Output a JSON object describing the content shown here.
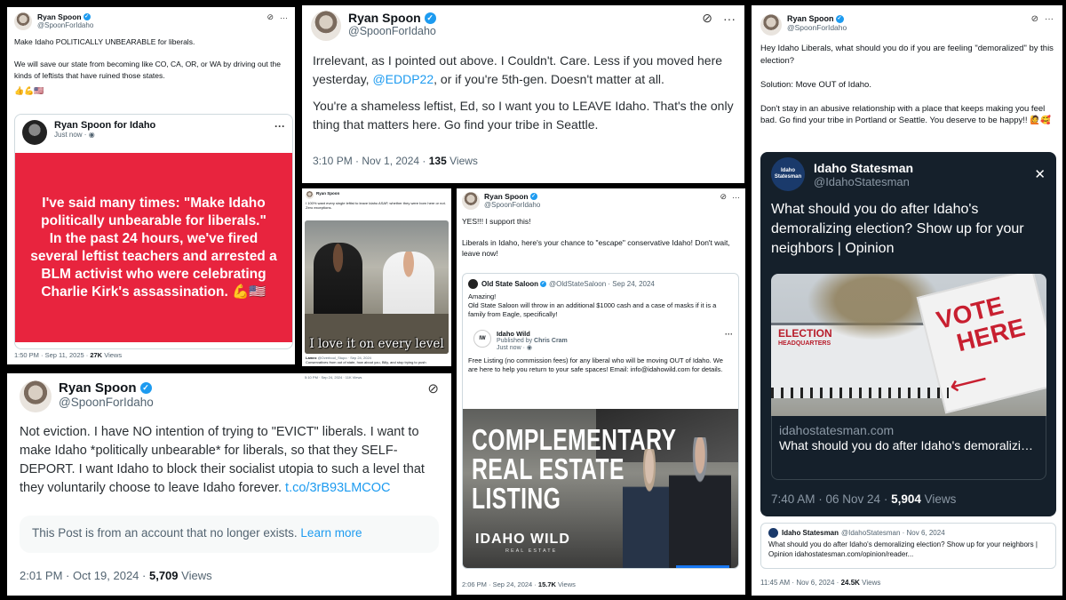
{
  "p1": {
    "name": "Ryan Spoon",
    "handle": "@SpoonForIdaho",
    "text": "Make Idaho POLITICALLY UNBEARABLE for liberals.\n\nWe will save our state from becoming like CO, CA, OR, or WA by driving out the kinds of leftists that have ruined those states.",
    "emoji": "👍💪🇺🇸",
    "card_name": "Ryan Spoon for Idaho",
    "card_time": "Just now ·",
    "banner": "I've said many times: \"Make Idaho politically unbearable for liberals.\"\nIn the past 24 hours, we've fired several leftist teachers and arrested a BLM activist who were celebrating Charlie Kirk's assassination. 💪🇺🇸",
    "time": "1:50 PM · Sep 11, 2025 ·",
    "views": "27K",
    "views_label": "Views"
  },
  "p2": {
    "name": "Ryan Spoon",
    "handle": "@SpoonForIdaho",
    "text_a": "Irrelevant, as I pointed out above. I Couldn't. Care. Less if you moved here yesterday, ",
    "mention": "@EDDP22",
    "text_b": ", or if you're 5th-gen. Doesn't matter at all.",
    "text_c": "You're a shameless leftist, Ed, so I want you to LEAVE Idaho. That's the only thing that matters here. Go find your tribe in Seattle.",
    "time": "3:10 PM · Nov 1, 2024 ·",
    "views": "135",
    "views_label": "Views"
  },
  "p3": {
    "name": "Ryan Spoon",
    "text": "I 100% want every single leftist to leave Idaho ASAP, whether they were born here or not. Zero exceptions.",
    "caption": "I love it on every level",
    "reply_name": "Lamez",
    "reply_meta": "@Overbool_Stupo · Sep 24, 2024",
    "reply_text": "Conservatives from out of state, how about you, Billy, and stop trying to push",
    "timestamp": "5:10 PM · Sep 24, 2024 · 11K Views"
  },
  "p4": {
    "name": "Ryan Spoon",
    "handle": "@SpoonForIdaho",
    "text": "YES!!! I support this!\n\nLiberals in Idaho, here's your chance to \"escape\" conservative Idaho! Don't wait, leave now!",
    "q_name": "Old State Saloon",
    "q_meta": "@OldStateSaloon · Sep 24, 2024",
    "q_text": "Amazing!\nOld State Saloon will throw in an additional $1000 cash and a case of masks if it is a family from Eagle, specifically!",
    "fb_name": "Idaho Wild",
    "fb_pub": "Published by",
    "fb_author": "Chris Cram",
    "fb_time": "Just now ·",
    "fb_text": "Free Listing (no commission fees) for any liberal who will be moving OUT of Idaho.  We are here to help you return to your safe spaces! Email: info@idahowild.com for details.",
    "ad_l1": "COMPLEMENTARY",
    "ad_l2": "REAL ESTATE",
    "ad_l3": "LISTING",
    "ad_brand": "IDAHO WILD",
    "ad_sub": "REAL ESTATE",
    "time": "2:06 PM · Sep 24, 2024 ·",
    "views": "15.7K",
    "views_label": "Views"
  },
  "p5": {
    "name": "Ryan Spoon",
    "handle": "@SpoonForIdaho",
    "text_a": "Not eviction. I have NO intention of trying to \"EVICT\" liberals. I want to make Idaho *politically unbearable* for liberals, so that they SELF-DEPORT. I want Idaho to block their socialist utopia to such a level that they voluntarily choose to leave Idaho forever. ",
    "link": "t.co/3rB93LMCOC",
    "notice": "This Post is from an account that no longer exists.",
    "notice_link": "Learn more",
    "time": "2:01 PM · Oct 19, 2024 ·",
    "views": "5,709",
    "views_label": "Views",
    "top_stamp": "5:10 PM · Sep 24, 2024 · 11K Views"
  },
  "p6": {
    "name": "Ryan Spoon",
    "handle": "@SpoonForIdaho",
    "text": "Hey Idaho Liberals, what should you do if you are feeling \"demoralized\" by this election?\n\nSolution: Move OUT of Idaho.\n\nDon't stay in an abusive relationship with a place that keeps making you feel bad. Go find your tribe in Portland or Seattle. You deserve to be happy!! 🙋🥰",
    "is_name": "Idaho Statesman",
    "is_handle": "@IdahoStatesman",
    "is_logo": "Idaho Statesman",
    "is_text": "What should you do after Idaho's demoralizing election? Show up for your neighbors | Opinion",
    "sign_vote": "VOTE",
    "sign_here": "HERE",
    "sign_elec": "ELECTION",
    "sign_hq": "HEADQUARTERS",
    "link_domain": "idahostatesman.com",
    "link_title": "What should you do after Idaho's demoralizing election? Show up for your nei...",
    "is_time": "7:40 AM · 06 Nov 24 ·",
    "is_views": "5,904",
    "is_views_label": "Views",
    "q_name": "Idaho Statesman",
    "q_meta": "@IdahoStatesman · Nov 6, 2024",
    "q_text": "What should you do after Idaho's demoralizing election? Show up for your neighbors | Opinion idahostatesman.com/opinion/reader...",
    "time": "11:45 AM · Nov 6, 2024 ·",
    "views": "24.5K",
    "views_label": "Views"
  },
  "colors": {
    "verified": "#1d9bf0",
    "banner_red": "#e8243e",
    "dark": "#15202b",
    "link": "#1d9bf0"
  },
  "icons": [
    "verified-badge-icon",
    "grok-icon",
    "more-icon",
    "globe-icon"
  ]
}
